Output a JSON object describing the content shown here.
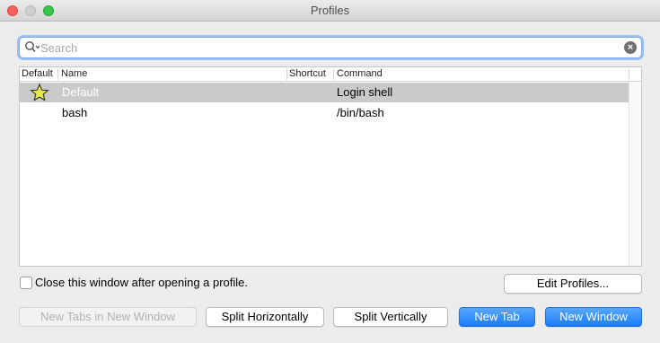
{
  "window": {
    "title": "Profiles"
  },
  "search": {
    "placeholder": "Search",
    "value": ""
  },
  "table": {
    "columns": [
      "Default",
      "Name",
      "Shortcut",
      "Command"
    ],
    "rows": [
      {
        "is_default": true,
        "name": "Default",
        "shortcut": "",
        "command": "Login shell",
        "selected": true
      },
      {
        "is_default": false,
        "name": "bash",
        "shortcut": "",
        "command": "/bin/bash",
        "selected": false
      }
    ]
  },
  "options": {
    "close_after_open_label": "Close this window after opening a profile.",
    "close_after_open_checked": false
  },
  "buttons": {
    "edit_profiles": "Edit Profiles...",
    "new_tabs_in_new_window": "New Tabs in New Window",
    "split_horizontally": "Split Horizontally",
    "split_vertically": "Split Vertically",
    "new_tab": "New Tab",
    "new_window": "New Window"
  },
  "colors": {
    "accent": "#1a7cf7",
    "selection": "#cacaca",
    "star_fill": "#e8e84a"
  },
  "icons": {
    "search": "search-icon",
    "clear": "clear-icon",
    "default_marker": "star-icon"
  }
}
